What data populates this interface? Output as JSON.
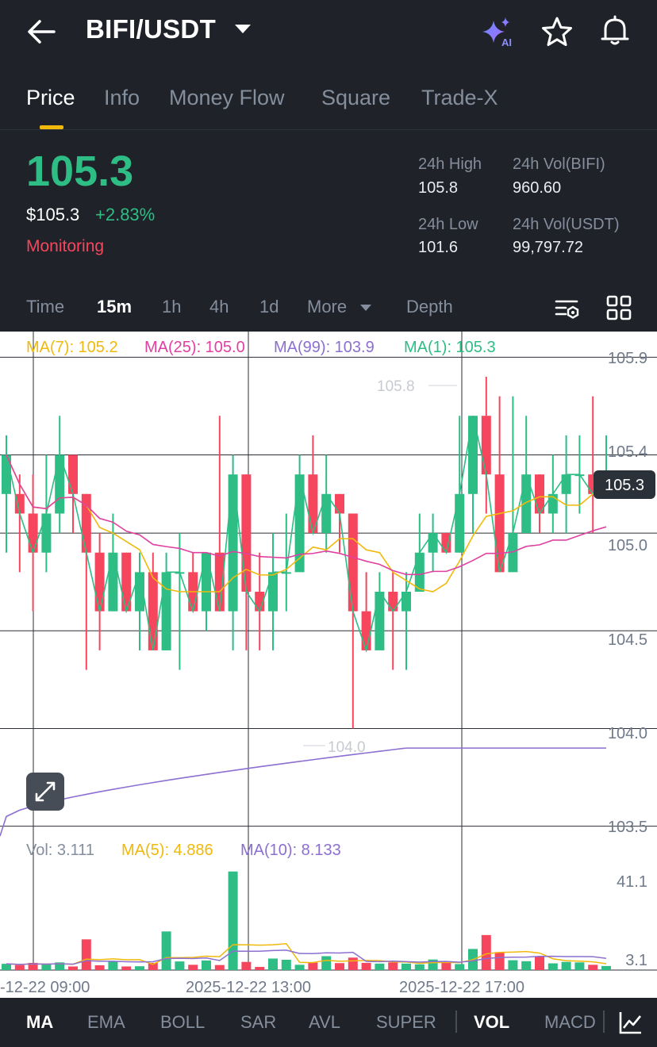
{
  "header": {
    "pair": "BIFI/USDT",
    "icons": [
      "back-arrow-icon",
      "ai-sparkle-icon",
      "star-icon",
      "bell-icon"
    ]
  },
  "tabs": [
    {
      "label": "Price",
      "active": true
    },
    {
      "label": "Info",
      "active": false
    },
    {
      "label": "Money Flow",
      "active": false
    },
    {
      "label": "Square",
      "active": false
    },
    {
      "label": "Trade-X",
      "active": false
    }
  ],
  "ticker": {
    "last_price": "105.3",
    "usd_price": "$105.3",
    "change": "+2.83%",
    "status": "Monitoring",
    "high_label": "24h High",
    "high_value": "105.8",
    "vol_base_label": "24h Vol(BIFI)",
    "vol_base_value": "960.60",
    "low_label": "24h Low",
    "low_value": "101.6",
    "vol_quote_label": "24h Vol(USDT)",
    "vol_quote_value": "99,797.72"
  },
  "intervals": [
    {
      "label": "Time",
      "active": false
    },
    {
      "label": "15m",
      "active": true
    },
    {
      "label": "1h",
      "active": false
    },
    {
      "label": "4h",
      "active": false
    },
    {
      "label": "1d",
      "active": false
    },
    {
      "label": "More",
      "active": false
    },
    {
      "label": "Depth",
      "active": false
    }
  ],
  "indicators": {
    "ma7": "MA(7): 105.2",
    "ma25": "MA(25): 105.0",
    "ma99": "MA(99): 103.9",
    "ma1": "MA(1): 105.3",
    "vol": "Vol: 3.111",
    "vol_ma5": "MA(5): 4.886",
    "vol_ma10": "MA(10): 8.133"
  },
  "price_axis": [
    "105.9",
    "105.4",
    "105.0",
    "104.5",
    "104.0",
    "103.5"
  ],
  "vol_axis": [
    "41.1",
    "3.1"
  ],
  "time_axis": [
    "-12-22 09:00",
    "2025-12-22 13:00",
    "2025-12-22 17:00"
  ],
  "price_marks": {
    "high": "105.8",
    "low": "104.0",
    "current": "105.3"
  },
  "colors": {
    "up": "#2ebd85",
    "down": "#f6465d",
    "ma7": "#f0b90b",
    "ma25": "#e040a0",
    "ma99": "#8c6fd1",
    "ma1": "#2ebd85",
    "accent": "#f0b90b"
  },
  "bottom_tabs": [
    {
      "label": "MA",
      "active": true
    },
    {
      "label": "EMA",
      "active": false
    },
    {
      "label": "BOLL",
      "active": false
    },
    {
      "label": "SAR",
      "active": false
    },
    {
      "label": "AVL",
      "active": false
    },
    {
      "label": "SUPER",
      "active": false
    },
    {
      "label": "VOL",
      "active": true
    },
    {
      "label": "MACD",
      "active": false
    }
  ],
  "chart_data": {
    "type": "candlestick",
    "ylim": [
      103.45,
      105.95
    ],
    "candles": [
      [
        105.2,
        105.4,
        104.9,
        105.5
      ],
      [
        105.2,
        105.1,
        104.8,
        105.3
      ],
      [
        105.1,
        104.9,
        104.6,
        105.3
      ],
      [
        104.9,
        105.1,
        104.8,
        105.4
      ],
      [
        105.1,
        105.4,
        105.0,
        105.6
      ],
      [
        105.4,
        105.2,
        105.0,
        105.4
      ],
      [
        105.2,
        104.9,
        104.3,
        105.2
      ],
      [
        104.9,
        104.6,
        104.4,
        105.0
      ],
      [
        104.6,
        104.9,
        104.6,
        105.1
      ],
      [
        104.9,
        104.6,
        104.6,
        104.9
      ],
      [
        104.6,
        104.8,
        104.4,
        104.9
      ],
      [
        104.8,
        104.4,
        104.4,
        104.9
      ],
      [
        104.4,
        104.8,
        104.4,
        104.9
      ],
      [
        104.8,
        104.8,
        104.3,
        105.0
      ],
      [
        104.8,
        104.6,
        104.6,
        104.9
      ],
      [
        104.6,
        104.9,
        104.5,
        104.9
      ],
      [
        104.9,
        104.6,
        104.6,
        105.6
      ],
      [
        104.6,
        105.3,
        104.4,
        105.4
      ],
      [
        105.3,
        104.7,
        104.4,
        105.3
      ],
      [
        104.7,
        104.6,
        104.4,
        104.9
      ],
      [
        104.6,
        104.8,
        104.4,
        105.0
      ],
      [
        104.8,
        104.8,
        104.6,
        105.1
      ],
      [
        104.8,
        105.3,
        105.0,
        105.4
      ],
      [
        105.3,
        105.0,
        105.0,
        105.5
      ],
      [
        105.0,
        105.2,
        104.9,
        105.4
      ],
      [
        105.2,
        105.1,
        104.9,
        105.2
      ],
      [
        105.1,
        104.6,
        104.0,
        105.0
      ],
      [
        104.6,
        104.4,
        104.4,
        104.8
      ],
      [
        104.4,
        104.7,
        104.5,
        104.8
      ],
      [
        104.7,
        104.6,
        104.3,
        104.8
      ],
      [
        104.6,
        104.7,
        104.3,
        104.8
      ],
      [
        104.7,
        104.9,
        104.7,
        105.1
      ],
      [
        104.9,
        105.0,
        104.8,
        105.1
      ],
      [
        105.0,
        104.9,
        104.9,
        105.0
      ],
      [
        104.9,
        105.2,
        104.9,
        105.6
      ],
      [
        105.2,
        105.6,
        105.0,
        105.6
      ],
      [
        105.6,
        105.3,
        105.1,
        105.8
      ],
      [
        105.3,
        104.8,
        104.9,
        105.7
      ],
      [
        104.8,
        105.0,
        104.9,
        105.7
      ],
      [
        105.0,
        105.3,
        105.0,
        105.6
      ],
      [
        105.3,
        105.1,
        105.0,
        105.3
      ],
      [
        105.1,
        105.2,
        105.0,
        105.4
      ],
      [
        105.2,
        105.3,
        105.0,
        105.5
      ],
      [
        105.3,
        105.3,
        105.1,
        105.5
      ],
      [
        105.3,
        105.2,
        105.0,
        105.7
      ],
      [
        105.2,
        105.3,
        105.2,
        105.5
      ]
    ],
    "volumes": [
      2.6,
      2.1,
      3.0,
      2.3,
      3.2,
      1.5,
      12.8,
      2.0,
      3.8,
      1.5,
      1.6,
      3.0,
      16.1,
      3.6,
      2.2,
      4.0,
      2.1,
      41.1,
      3.4,
      1.3,
      4.8,
      4.3,
      2.2,
      3.1,
      5.8,
      2.9,
      5.2,
      3.0,
      2.7,
      3.2,
      2.7,
      2.4,
      4.4,
      3.5,
      2.5,
      8.8,
      14.6,
      7.5,
      4.1,
      3.7,
      5.5,
      2.8,
      3.4,
      3.2,
      2.2,
      1.7
    ],
    "vol_ylim": [
      0,
      43
    ]
  }
}
